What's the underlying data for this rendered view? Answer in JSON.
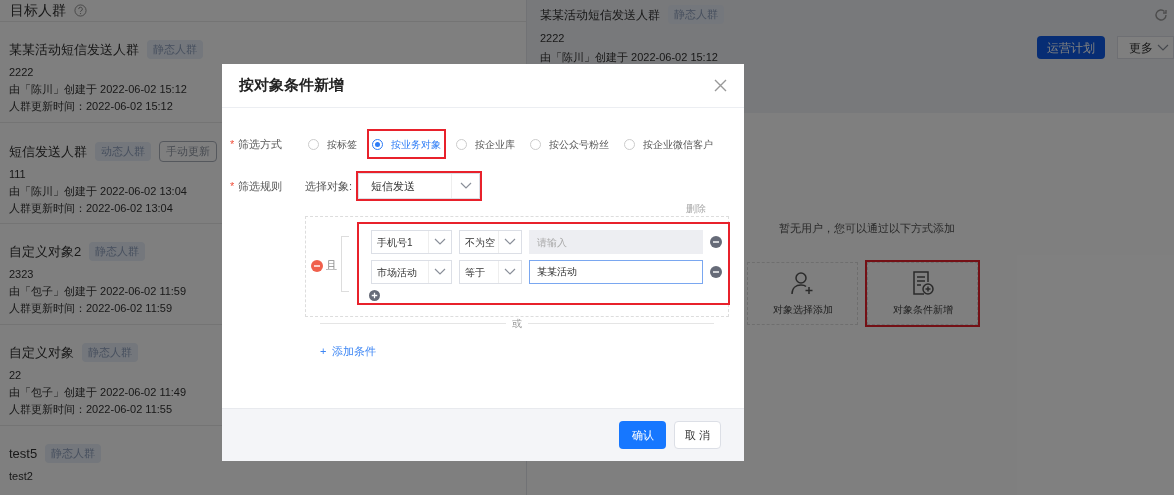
{
  "left_panel": {
    "title": "目标人群",
    "groups": [
      {
        "name": "某某活动短信发送人群",
        "tags": [
          {
            "label": "静态人群",
            "kind": "filled"
          }
        ],
        "description": "2222",
        "creator": "由「陈川」创建于 2022-06-02 15:12",
        "updated": "人群更新时间：2022-06-02 15:12"
      },
      {
        "name": "短信发送人群",
        "tags": [
          {
            "label": "动态人群",
            "kind": "filled"
          },
          {
            "label": "手动更新",
            "kind": "outline"
          }
        ],
        "description": "111",
        "creator": "由「陈川」创建于 2022-06-02 13:04",
        "updated": "人群更新时间：2022-06-02 13:04"
      },
      {
        "name": "自定义对象2",
        "tags": [
          {
            "label": "静态人群",
            "kind": "filled"
          }
        ],
        "description": "2323",
        "creator": "由「包子」创建于 2022-06-02 11:59",
        "updated": "人群更新时间：2022-06-02 11:59"
      },
      {
        "name": "自定义对象",
        "tags": [
          {
            "label": "静态人群",
            "kind": "filled"
          }
        ],
        "description": "22",
        "creator": "由「包子」创建于 2022-06-02 11:49",
        "updated": "人群更新时间：2022-06-02 11:55"
      },
      {
        "name": "test5",
        "tags": [
          {
            "label": "静态人群",
            "kind": "filled"
          }
        ],
        "description": "test2"
      }
    ]
  },
  "detail": {
    "name": "某某活动短信发送人群",
    "tag": "静态人群",
    "description": "2222",
    "creator": "由「陈川」创建于 2022-06-02 15:12",
    "buttons": [
      {
        "label": "运营计划",
        "kind": "primary"
      },
      {
        "label": "更多",
        "kind": "dropdown"
      }
    ],
    "empty_text": "暂无用户，您可以通过以下方式添加",
    "add_options": [
      {
        "label": "对象选择添加",
        "kind": "person",
        "highlighted": false
      },
      {
        "label": "对象条件新增",
        "kind": "document",
        "highlighted": true
      }
    ]
  },
  "dialog": {
    "title": "按对象条件新增",
    "filter_mode": {
      "label": "筛选方式",
      "required_mark": "*",
      "options": [
        {
          "label": "按标签",
          "selected": false,
          "highlighted": false
        },
        {
          "label": "按业务对象",
          "selected": true,
          "highlighted": true
        },
        {
          "label": "按企业库",
          "selected": false,
          "highlighted": false
        },
        {
          "label": "按公众号粉丝",
          "selected": false,
          "highlighted": false
        },
        {
          "label": "按企业微信客户",
          "selected": false,
          "highlighted": false
        }
      ]
    },
    "filter_rule": {
      "label": "筛选规则",
      "required_mark": "*",
      "object_label": "选择对象:",
      "object_value": "短信发送",
      "object_highlighted": true,
      "delete_label": "删除",
      "logic": "且",
      "conditions_highlighted": true,
      "conditions": [
        {
          "field": "手机号1",
          "operator": "不为空",
          "placeholder": "请输入",
          "disabled": true
        },
        {
          "field": "市场活动",
          "operator": "等于",
          "value": "某某活动",
          "disabled": false
        }
      ],
      "or_label": "或",
      "add_icon": "+",
      "add_label": "添加条件"
    },
    "buttons": [
      {
        "label": "确认",
        "kind": "primary"
      },
      {
        "label": "取 消",
        "kind": "default"
      }
    ]
  }
}
